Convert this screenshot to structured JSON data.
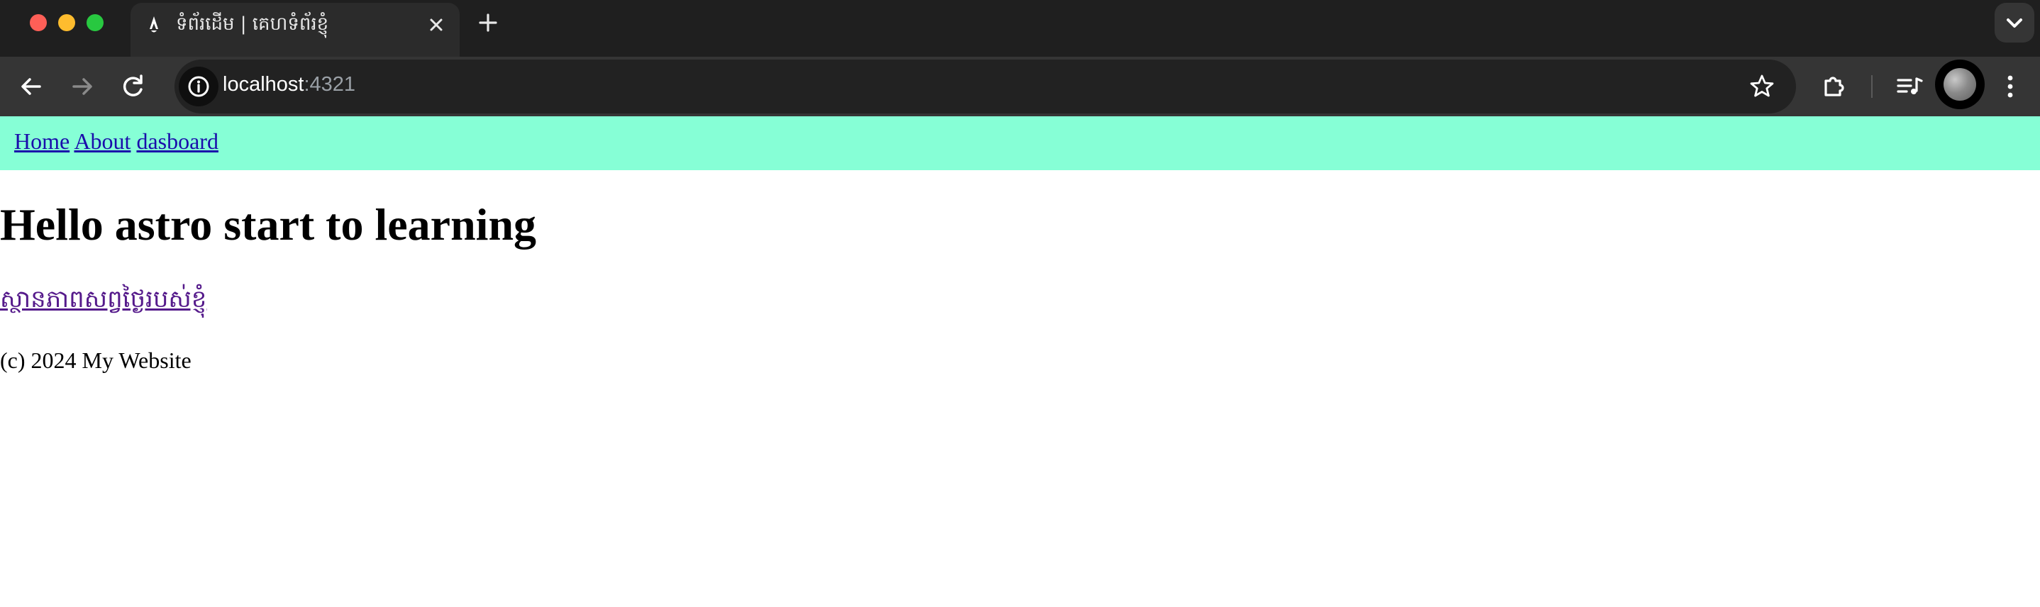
{
  "browser": {
    "tab": {
      "title": "ទំព័រដើម | គេហទំព័រខ្ញុំ",
      "favicon": "astro-rocket-icon"
    },
    "address_bar": {
      "host": "localhost",
      "port": ":4321"
    },
    "icons": {
      "back": "arrow-left-icon",
      "forward": "arrow-right-icon",
      "reload": "reload-icon",
      "site_info": "info-icon",
      "bookmark": "star-icon",
      "extensions": "puzzle-icon",
      "media": "media-playlist-icon",
      "profile": "avatar",
      "menu": "kebab-menu-icon",
      "new_tab": "plus-icon",
      "tab_search": "chevron-down-icon",
      "close_tab": "close-icon"
    }
  },
  "site": {
    "nav": {
      "items": [
        {
          "label": "Home"
        },
        {
          "label": "About"
        },
        {
          "label": "dasboard"
        }
      ]
    },
    "heading": "Hello astro start to learning",
    "khmer_link": "ស្ថានភាពសព្វថ្ងៃរបស់ខ្ញុំ",
    "footer": "(c) 2024 My Website"
  },
  "colors": {
    "nav_background": "#86ffd6",
    "link": "#1a0dab",
    "visited_link": "#551a8b"
  }
}
